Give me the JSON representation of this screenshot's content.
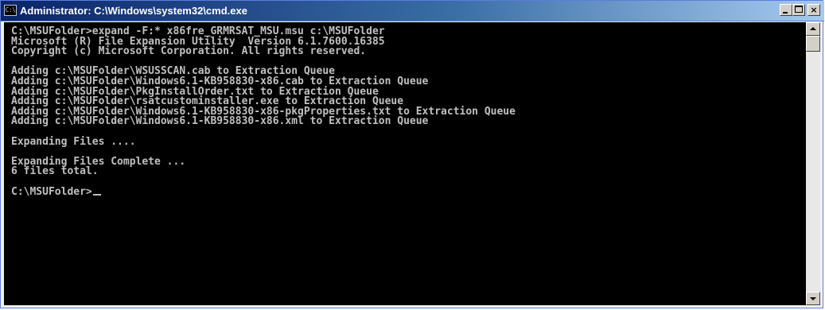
{
  "window": {
    "title": "Administrator: C:\\Windows\\system32\\cmd.exe",
    "icon": "cmd-icon",
    "icon_text": "C:\\",
    "border_color": "#5a7edc"
  },
  "console": {
    "background": "#000000",
    "foreground": "#c0c0c0",
    "lines": [
      "C:\\MSUFolder>expand -F:* x86fre_GRMRSAT_MSU.msu c:\\MSUFolder",
      "Microsoft (R) File Expansion Utility  Version 6.1.7600.16385",
      "Copyright (c) Microsoft Corporation. All rights reserved.",
      "",
      "Adding c:\\MSUFolder\\WSUSSCAN.cab to Extraction Queue",
      "Adding c:\\MSUFolder\\Windows6.1-KB958830-x86.cab to Extraction Queue",
      "Adding c:\\MSUFolder\\PkgInstallOrder.txt to Extraction Queue",
      "Adding c:\\MSUFolder\\rsatcustominstaller.exe to Extraction Queue",
      "Adding c:\\MSUFolder\\Windows6.1-KB958830-x86-pkgProperties.txt to Extraction Queue",
      "Adding c:\\MSUFolder\\Windows6.1-KB958830-x86.xml to Extraction Queue",
      "",
      "Expanding Files ....",
      "",
      "Expanding Files Complete ...",
      "6 files total.",
      ""
    ],
    "prompt": "C:\\MSUFolder>"
  },
  "scrollbar": {
    "up_icon": "scroll-up-arrow-icon",
    "down_icon": "scroll-down-arrow-icon",
    "position": 0
  }
}
